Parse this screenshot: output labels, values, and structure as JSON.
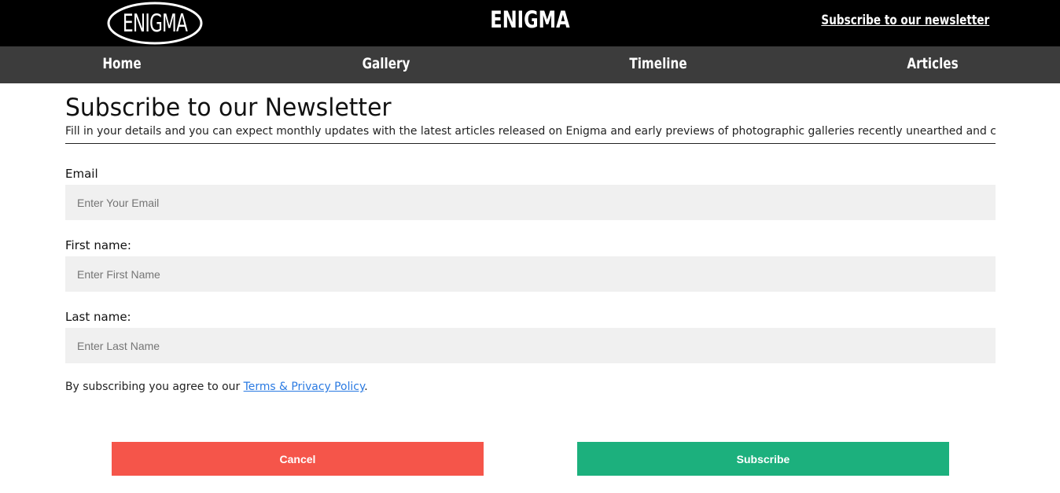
{
  "header": {
    "logo_text": "ENIGMA",
    "site_title": "ENIGMA",
    "subscribe_link": "Subscribe to our newsletter"
  },
  "nav": {
    "items": [
      {
        "label": "Home"
      },
      {
        "label": "Gallery"
      },
      {
        "label": "Timeline"
      },
      {
        "label": "Articles"
      }
    ]
  },
  "page": {
    "heading": "Subscribe to our Newsletter",
    "intro": "Fill in your details and you can expect monthly updates with the latest articles released on Enigma and early previews of photographic galleries recently unearthed and compiled."
  },
  "form": {
    "email": {
      "label": "Email",
      "placeholder": "Enter Your Email",
      "value": ""
    },
    "first_name": {
      "label": "First name:",
      "placeholder": "Enter First Name",
      "value": ""
    },
    "last_name": {
      "label": "Last name:",
      "placeholder": "Enter Last Name",
      "value": ""
    },
    "consent_prefix": "By subscribing you agree to our ",
    "consent_link": "Terms & Privacy Policy",
    "consent_suffix": ".",
    "cancel_label": "Cancel",
    "subscribe_label": "Subscribe"
  },
  "colors": {
    "topbar": "#000000",
    "navbar": "#3c3c3c",
    "input_bg": "#f0f0f0",
    "cancel": "#f5554a",
    "subscribe": "#1cb07d",
    "link": "#2a7ae2"
  }
}
